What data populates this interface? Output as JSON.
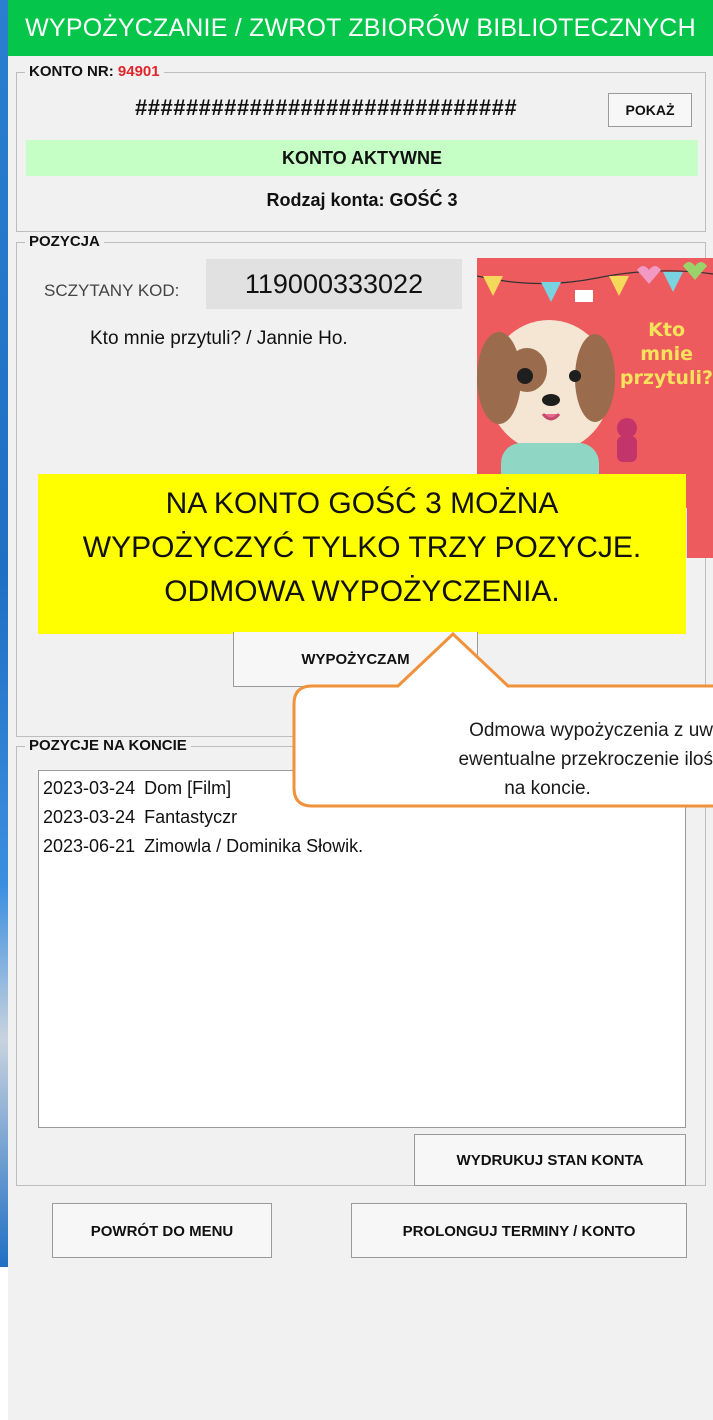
{
  "window": {
    "title": "WYPOŻYCZANIE / ZWROT ZBIORÓW BIBLIOTECZNYCH"
  },
  "account": {
    "label": "KONTO NR:",
    "number": "94901",
    "masked": "##############################",
    "show_label": "POKAŻ",
    "status": "KONTO AKTYWNE",
    "type_text": "Rodzaj konta: GOŚĆ 3",
    "status_color": "#c6ffc6"
  },
  "position": {
    "label": "POZYCJA",
    "scanned_label": "SCZYTANY KOD:",
    "scanned_code": "119000333022",
    "item_title": "Kto mnie przytuli? / Jannie Ho.",
    "cover_text": [
      "Kto",
      "mnie",
      "przytuli?"
    ],
    "lend_label": "WYPOŻYCZAM"
  },
  "alert": {
    "lines": [
      "NA KONTO GOŚĆ 3 MOŻNA",
      "WYPOŻYCZYĆ TYLKO TRZY POZYCJE.",
      "ODMOWA WYPOŻYCZENIA."
    ],
    "color": "#ffff00"
  },
  "callout": {
    "lines": [
      "Odmowa wypożyczenia z uw",
      "ewentualne przekroczenie iloś",
      "na koncie."
    ],
    "border_color": "#f0913b"
  },
  "positions_list": {
    "label": "POZYCJE NA KONCIE",
    "items": [
      {
        "date": "2023-03-24",
        "title": "Dom [Film]"
      },
      {
        "date": "2023-03-24",
        "title": "Fantastyczr"
      },
      {
        "date": "2023-06-21",
        "title": "Zimowla / Dominika Słowik."
      }
    ],
    "print_label": "WYDRUKUJ STAN KONTA"
  },
  "footer": {
    "back_label": "POWRÓT DO MENU",
    "extend_label": "PROLONGUJ TERMINY / KONTO"
  },
  "colors": {
    "title_bar": "#05c64a"
  }
}
